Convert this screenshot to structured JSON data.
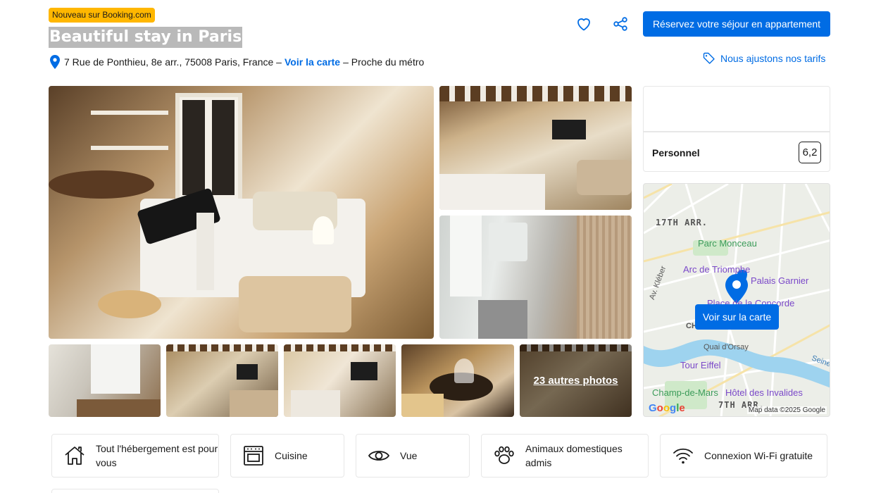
{
  "header": {
    "badge": "Nouveau sur Booking.com",
    "title": "Beautiful stay in Paris",
    "address": "7 Rue de Ponthieu, 8e arr., 75008 Paris, France –",
    "map_link": "Voir la carte",
    "proximity": "– Proche du métro",
    "reserve_button": "Réservez votre séjour en appartement",
    "price_match": "Nous ajustons nos tarifs",
    "heart_icon": "heart-icon",
    "share_icon": "share-icon"
  },
  "gallery": {
    "more_photos": "23 autres photos"
  },
  "reviews": {
    "category": "Personnel",
    "score": "6,2"
  },
  "map": {
    "button": "Voir sur la carte",
    "labels": {
      "arr17": "17TH ARR.",
      "parc": "Parc Monceau",
      "arc": "Arc de Triomphe",
      "palais": "Palais Garnier",
      "concorde": "Place de la Concorde",
      "kleber": "Av. Kléber",
      "quai": "Quai d'Orsay",
      "seine": "Seine",
      "eiffel": "Tour Eiffel",
      "champ": "Champ-de-Mars",
      "invalides": "Hôtel des Invalides",
      "arr7": "7TH ARR.",
      "ch": "CH"
    },
    "google": "Google",
    "copyright": "Map data ©2025 Google"
  },
  "facilities": [
    {
      "label": "Tout l'hébergement est pour vous",
      "icon": "house-icon"
    },
    {
      "label": "Cuisine",
      "icon": "oven-icon"
    },
    {
      "label": "Vue",
      "icon": "eye-icon"
    },
    {
      "label": "Animaux domestiques admis",
      "icon": "paw-icon"
    },
    {
      "label": "Connexion Wi-Fi gratuite",
      "icon": "wifi-icon"
    }
  ],
  "colors": {
    "brand_blue": "#006ce4",
    "badge_yellow": "#ffb700",
    "title_highlight": "#b9b9b9"
  }
}
